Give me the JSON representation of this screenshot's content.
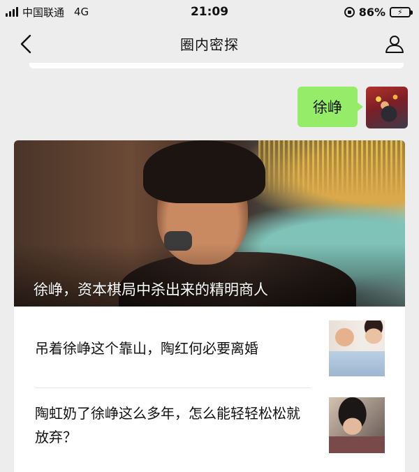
{
  "status_bar": {
    "carrier": "中国联通",
    "network": "4G",
    "time": "21:09",
    "battery": "86%",
    "battery_level": 0.86
  },
  "nav": {
    "title": "圈内密探",
    "back_icon": "chevron-left-icon",
    "profile_icon": "person-icon"
  },
  "message": {
    "text": "徐峥",
    "bubble_color": "#95ec69"
  },
  "article_card": {
    "hero_title": "徐峥，资本棋局中杀出来的精明商人",
    "items": [
      {
        "title": "吊着徐峥这个靠山，陶红何必要离婚"
      },
      {
        "title": "陶虹奶了徐峥这么多年，怎么能轻轻松松就放弃？"
      }
    ]
  }
}
